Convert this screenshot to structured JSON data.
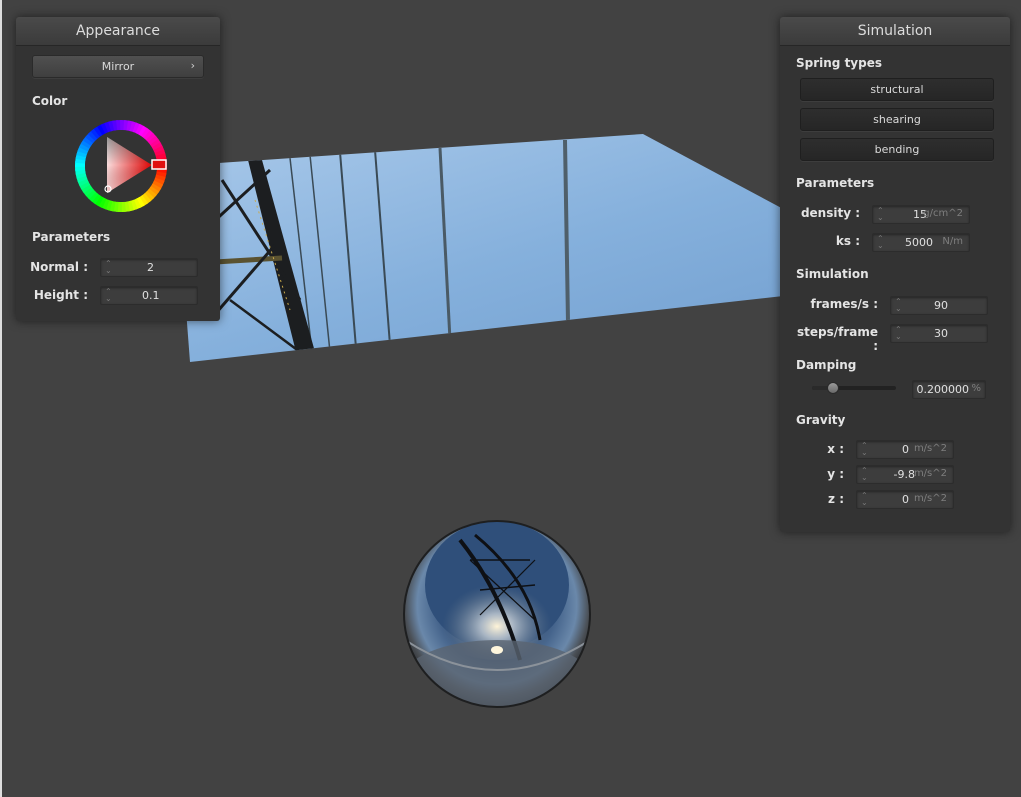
{
  "appearance": {
    "title": "Appearance",
    "material_label": "Mirror",
    "color_label": "Color",
    "parameters_label": "Parameters",
    "normal_label": "Normal :",
    "normal_value": "2",
    "height_label": "Height :",
    "height_value": "0.1",
    "accent_color": "#e01010"
  },
  "simulation": {
    "title": "Simulation",
    "spring_types_label": "Spring types",
    "spring_buttons": [
      "structural",
      "shearing",
      "bending"
    ],
    "parameters_label": "Parameters",
    "density_label": "density :",
    "density_value": "15",
    "density_unit": "g/cm^2",
    "ks_label": "ks :",
    "ks_value": "5000",
    "ks_unit": "N/m",
    "simulation_label": "Simulation",
    "fps_label": "frames/s :",
    "fps_value": "90",
    "steps_label": "steps/frame :",
    "steps_value": "30",
    "damping_label": "Damping",
    "damping_value": "0.200000",
    "damping_unit": "%",
    "damping_level": 0.2,
    "gravity_label": "Gravity",
    "gx_label": "x :",
    "gx_value": "0",
    "gx_unit": "m/s^2",
    "gy_label": "y :",
    "gy_value": "-9.8",
    "gy_unit": "m/s^2",
    "gz_label": "z :",
    "gz_value": "0",
    "gz_unit": "m/s^2"
  },
  "icons": {
    "chevron": "chevron-right-icon",
    "spin": "spinner-icon"
  }
}
